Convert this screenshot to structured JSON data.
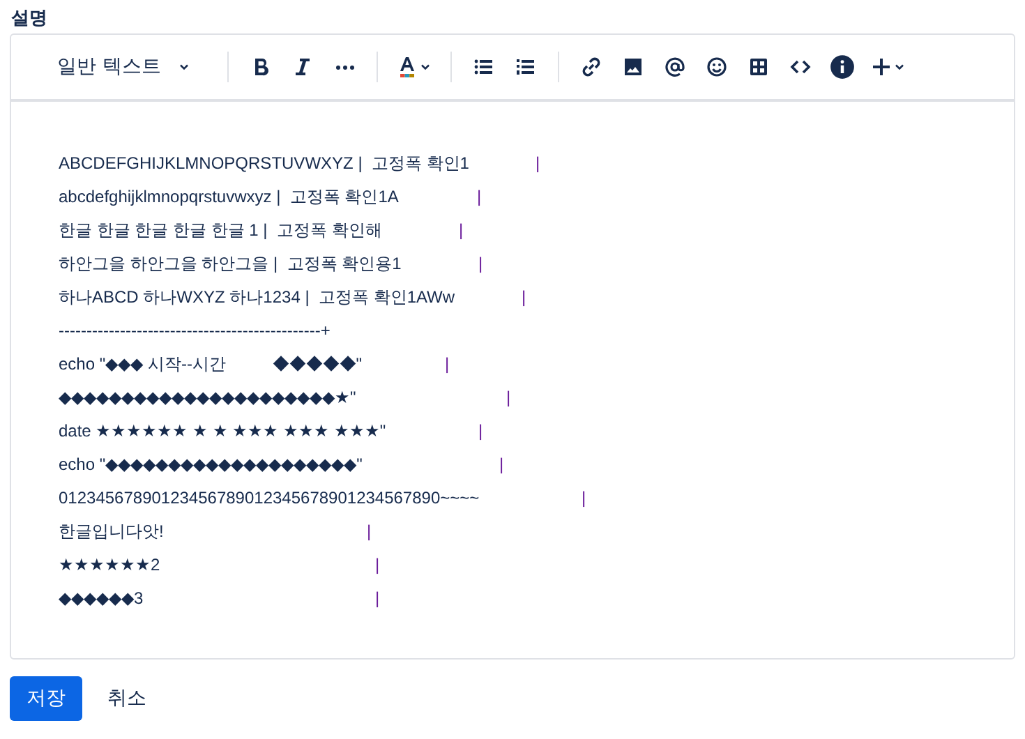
{
  "field_label": "설명",
  "toolbar": {
    "text_style": "일반 텍스트"
  },
  "lines": [
    {
      "text": "ABCDEFGHIJKLMNOPQRSTUVWXYZ |  고정폭 확인1",
      "tail": "|"
    },
    {
      "text": "abcdefghijklmnopqrstuvwxyz |  고정폭 확인1A",
      "tail": "|"
    },
    {
      "text": "한글 한글 한글 한글 한글 1 |  고정폭 확인해",
      "tail": "|"
    },
    {
      "text": "하안그을 하안그을 하안그을 |  고정폭 확인용1",
      "tail": "|"
    },
    {
      "text": "하나ABCD 하나WXYZ 하나1234 |  고정폭 확인1AWw",
      "tail": "|"
    },
    {
      "text": "-----------------------------------------------+"
    },
    {
      "text": "echo \"◆◆◆ 시작--시간          ◆◆◆◆◆\"",
      "tail": "|"
    },
    {
      "text": "◆◆◆◆◆◆◆◆◆◆◆◆◆◆◆◆◆◆◆◆◆◆★\"",
      "tail": "|"
    },
    {
      "text": "date ★★★★★★ ★ ★ ★★★ ★★★ ★★★\"",
      "tail": "|"
    },
    {
      "text": "echo \"◆◆◆◆◆◆◆◆◆◆◆◆◆◆◆◆◆◆◆◆\"",
      "tail": "|"
    },
    {
      "text": "01234567890123456789012345678901234567890~~~~",
      "tail": "|"
    },
    {
      "text": "한글입니다앗!",
      "tail": "|"
    },
    {
      "text": "★★★★★★2",
      "tail": "|"
    },
    {
      "text": "◆◆◆◆◆◆3",
      "tail": "|"
    }
  ],
  "buttons": {
    "save": "저장",
    "cancel": "취소"
  }
}
